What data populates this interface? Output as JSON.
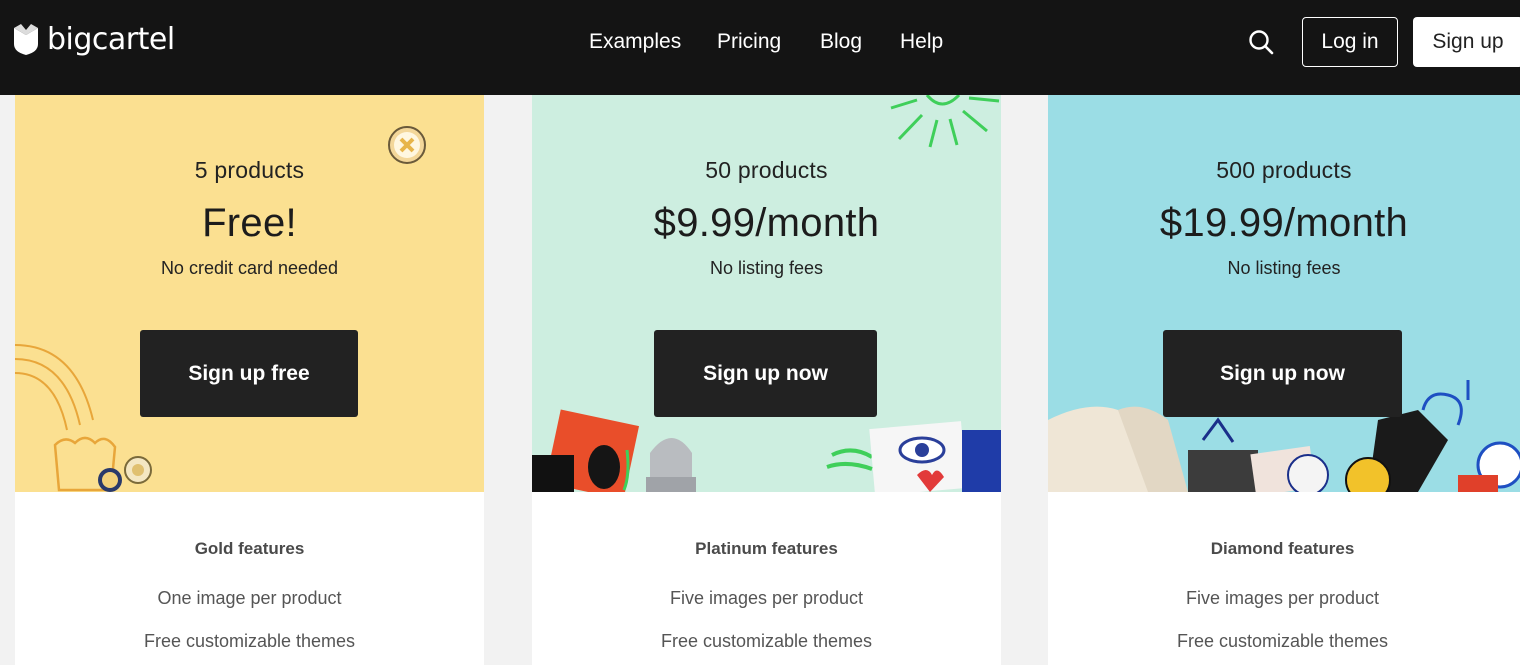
{
  "header": {
    "logo_text": "bigcartel",
    "nav": [
      "Examples",
      "Pricing",
      "Blog",
      "Help"
    ],
    "login_label": "Log in",
    "signup_label": "Sign up"
  },
  "plans": [
    {
      "products": "5 products",
      "price": "Free!",
      "note": "No credit card needed",
      "cta": "Sign up free",
      "features_title": "Gold features",
      "features": [
        "One image per product",
        "Free customizable themes"
      ],
      "color": "#fbe091"
    },
    {
      "products": "50 products",
      "price": "$9.99/month",
      "note": "No listing fees",
      "cta": "Sign up now",
      "features_title": "Platinum features",
      "features": [
        "Five images per product",
        "Free customizable themes"
      ],
      "color": "#cdeee0"
    },
    {
      "products": "500 products",
      "price": "$19.99/month",
      "note": "No listing fees",
      "cta": "Sign up now",
      "features_title": "Diamond features",
      "features": [
        "Five images per product",
        "Free customizable themes"
      ],
      "color": "#9bdde5"
    }
  ]
}
